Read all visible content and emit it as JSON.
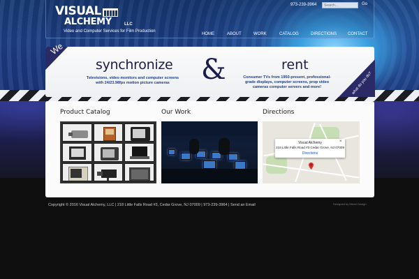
{
  "header": {
    "logo_line1": "VISUAL",
    "logo_line2": "ALCHEMY",
    "logo_llc": "LLC",
    "tagline": "Video and Computer Services for Film Production",
    "phone": "973-239-3964",
    "search": {
      "placeholder": "Search...",
      "go_label": "Go"
    }
  },
  "nav": {
    "items": [
      {
        "label": "HOME"
      },
      {
        "label": "ABOUT"
      },
      {
        "label": "WORK"
      },
      {
        "label": "CATALOG"
      },
      {
        "label": "DIRECTIONS"
      },
      {
        "label": "CONTACT"
      }
    ]
  },
  "banner": {
    "we": "We",
    "left_title": "synchronize",
    "left_desc": "Televisions, video monitors and computer screens with 24/23.98fps motion picture cameras",
    "amp": "&",
    "right_title": "rent",
    "right_desc": "Consumer TVs from 1950-present, professional-grade displays, computer screens, prop video cameras computer servers and more!",
    "side_text": "what do you do?"
  },
  "sections": {
    "catalog_title": "Product Catalog",
    "work_title": "Our Work",
    "directions_title": "Directions"
  },
  "map": {
    "place": "Visual Alchemy",
    "address": "218 Little Falls Road #3 Cedar Grove, NJ 07009",
    "link": "Directions",
    "close": "×"
  },
  "footer": {
    "copyright": "Copyright © 2016 Visual Alchemy, LLC | 218 Little Falls Road #3, Cedar Grove, NJ 07009 | 973-239-3964 | Send an Email",
    "credit": "Designed by Mbuvi Design"
  },
  "colors": {
    "accent_dark": "#1c1c4a",
    "desc_blue": "#1f3c88",
    "header_blue": "#1d3f86",
    "map_pin": "#d93025",
    "link_blue": "#1a55c7"
  }
}
